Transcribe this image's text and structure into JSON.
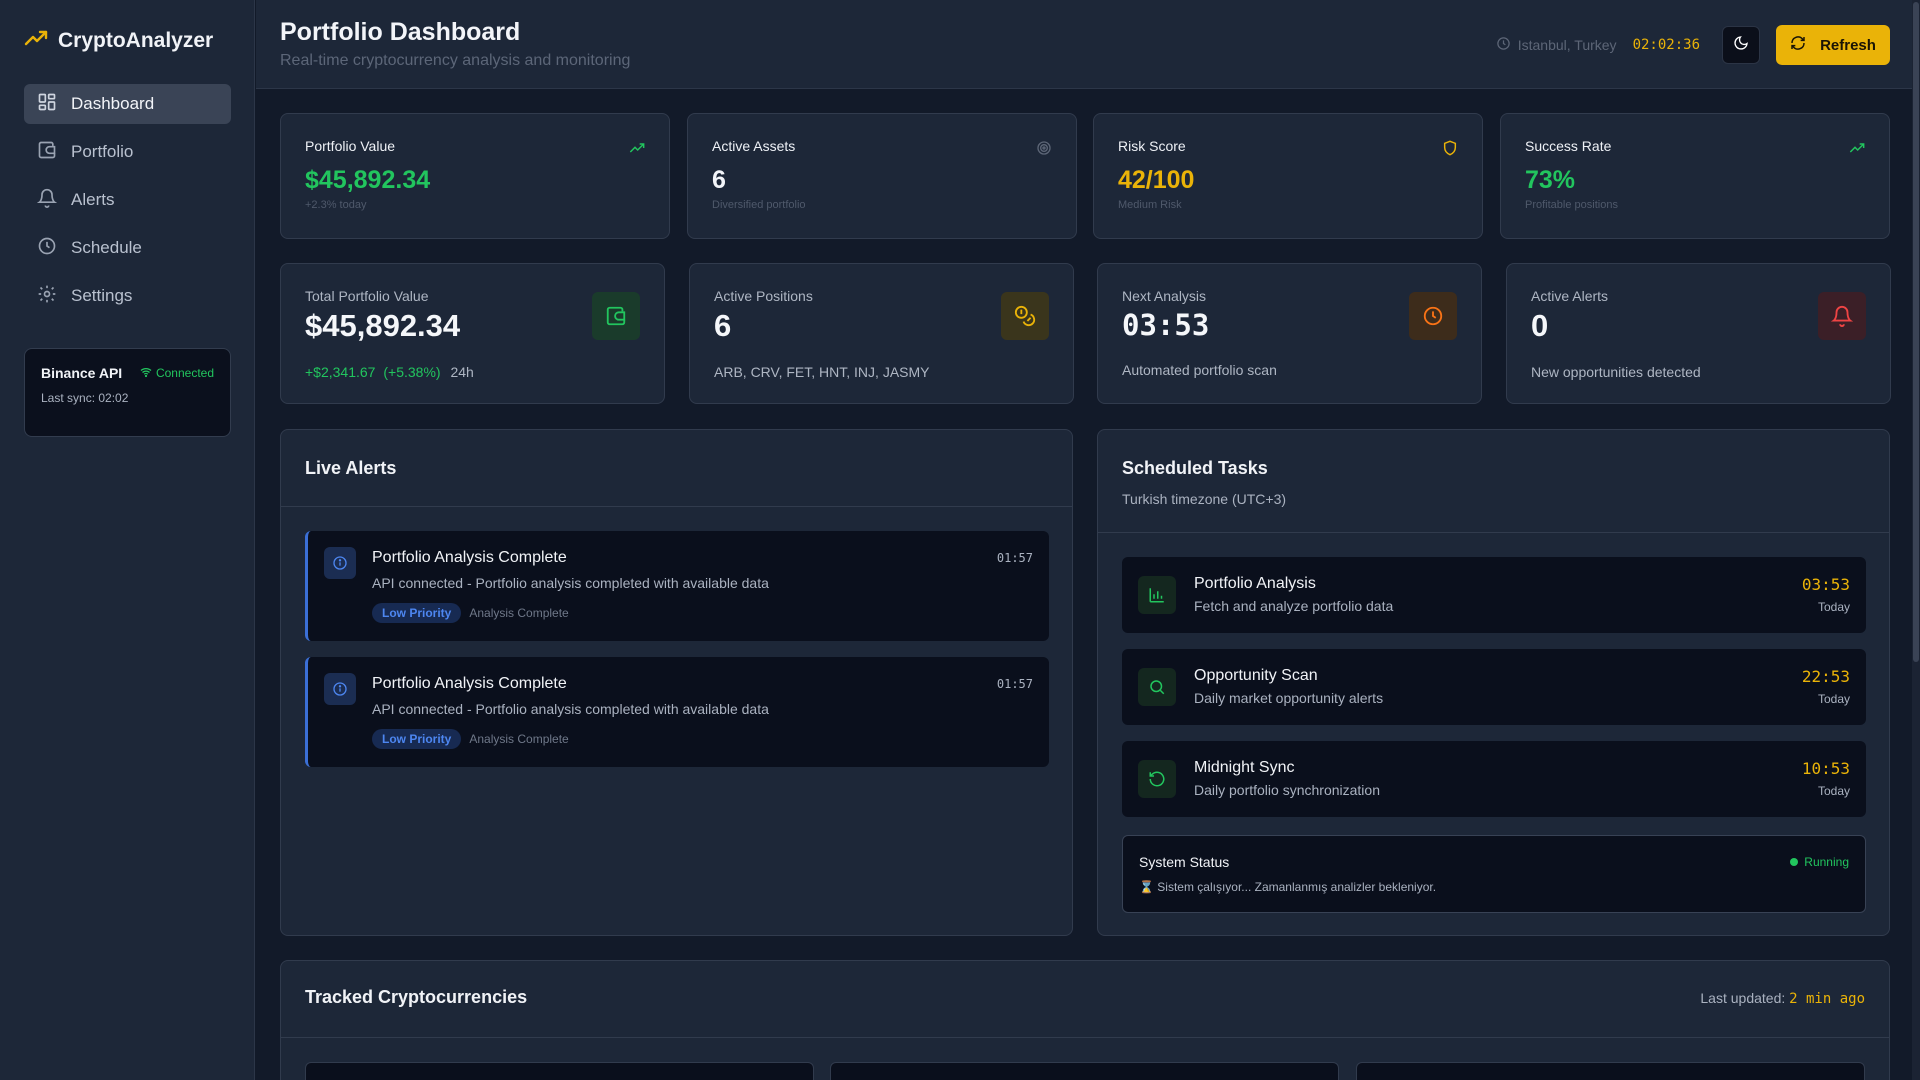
{
  "brand": {
    "name": "CryptoAnalyzer"
  },
  "sidebar": {
    "items": [
      {
        "label": "Dashboard",
        "icon": "dashboard-icon",
        "active": true
      },
      {
        "label": "Portfolio",
        "icon": "wallet-icon"
      },
      {
        "label": "Alerts",
        "icon": "bell-icon"
      },
      {
        "label": "Schedule",
        "icon": "clock-icon"
      },
      {
        "label": "Settings",
        "icon": "gear-icon"
      }
    ],
    "api": {
      "title": "Binance API",
      "status": "Connected",
      "sync": "Last sync: 02:02"
    }
  },
  "header": {
    "title": "Portfolio Dashboard",
    "subtitle": "Real-time cryptocurrency analysis and monitoring",
    "location": "Istanbul, Turkey",
    "time": "02:02:36",
    "refresh_label": "Refresh"
  },
  "stats": [
    {
      "label": "Portfolio Value",
      "value": "$45,892.34",
      "sub": "+2.3% today",
      "color": "#22c55e"
    },
    {
      "label": "Active Assets",
      "value": "6",
      "sub": "Diversified portfolio",
      "color": "#f3f5f9"
    },
    {
      "label": "Risk Score",
      "value": "42/100",
      "sub": "Medium Risk",
      "color": "#eab308"
    },
    {
      "label": "Success Rate",
      "value": "73%",
      "sub": "Profitable positions",
      "color": "#22c55e"
    }
  ],
  "overview": [
    {
      "label": "Total Portfolio Value",
      "value": "$45,892.34",
      "change": "+$2,341.67",
      "change_pct": "(+5.38%)",
      "period": "24h"
    },
    {
      "label": "Active Positions",
      "value": "6",
      "sub": "ARB, CRV, FET, HNT, INJ, JASMY"
    },
    {
      "label": "Next Analysis",
      "value": "03:53",
      "sub": "Automated portfolio scan"
    },
    {
      "label": "Active Alerts",
      "value": "0",
      "sub": "New opportunities detected"
    }
  ],
  "alerts": {
    "title": "Live Alerts",
    "items": [
      {
        "title": "Portfolio Analysis Complete",
        "desc": "API connected - Portfolio analysis completed with available data",
        "time": "01:57",
        "priority": "Low Priority",
        "tag": "Analysis Complete"
      },
      {
        "title": "Portfolio Analysis Complete",
        "desc": "API connected - Portfolio analysis completed with available data",
        "time": "01:57",
        "priority": "Low Priority",
        "tag": "Analysis Complete"
      }
    ]
  },
  "schedule": {
    "title": "Scheduled Tasks",
    "subtitle": "Turkish timezone (UTC+3)",
    "tasks": [
      {
        "title": "Portfolio Analysis",
        "desc": "Fetch and analyze portfolio data",
        "time": "03:53",
        "day": "Today",
        "icon": "bar-chart-icon"
      },
      {
        "title": "Opportunity Scan",
        "desc": "Daily market opportunity alerts",
        "time": "22:53",
        "day": "Today",
        "icon": "search-icon"
      },
      {
        "title": "Midnight Sync",
        "desc": "Daily portfolio synchronization",
        "time": "10:53",
        "day": "Today",
        "icon": "sync-icon"
      }
    ],
    "system": {
      "title": "System Status",
      "status": "Running",
      "message": "⌛ Sistem çalışıyor... Zamanlanmış analizler bekleniyor."
    }
  },
  "tracked": {
    "title": "Tracked Cryptocurrencies",
    "updated_label": "Last updated:",
    "updated_value": "2 min ago"
  },
  "colors": {
    "accent": "#eab308",
    "positive": "#22c55e",
    "info": "#3b82f6",
    "danger": "#ef4444"
  }
}
